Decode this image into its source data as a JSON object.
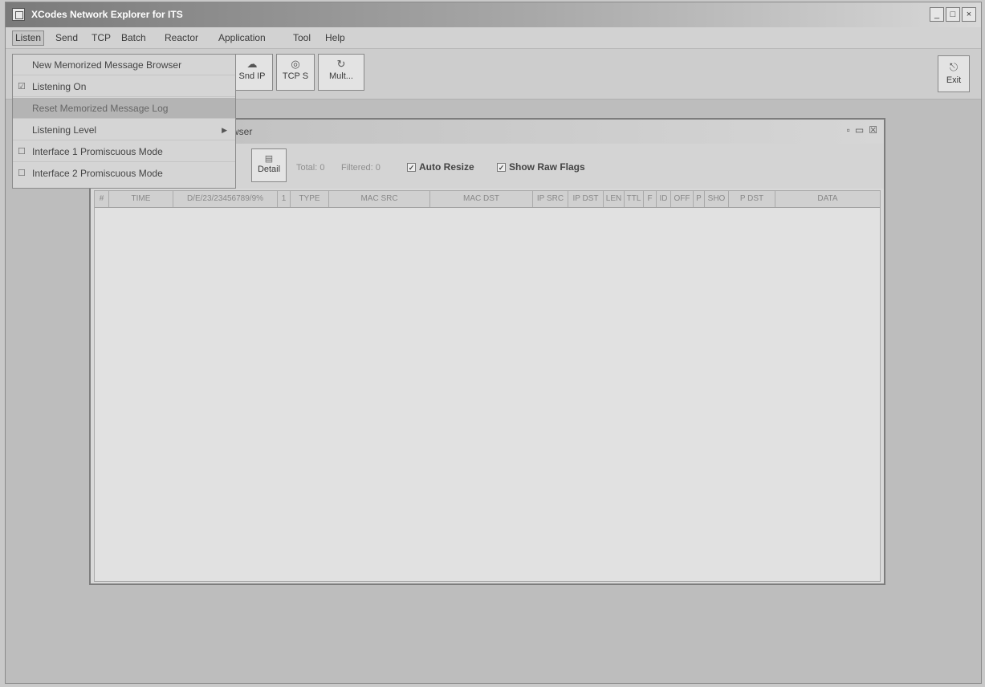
{
  "window": {
    "title": "XCodes Network Explorer for ITS"
  },
  "menubar": [
    "Listen",
    "Send",
    "TCP",
    "Batch",
    "Reactor",
    "Application",
    "Tool",
    "Help"
  ],
  "toolbar": {
    "buttons": [
      {
        "label": "Snd IP",
        "icon": "network-icon"
      },
      {
        "label": "TCP S",
        "icon": "plug-icon"
      },
      {
        "label": "Mult...",
        "icon": "refresh-icon"
      }
    ],
    "exit": "Exit"
  },
  "listen_menu": [
    {
      "label": "New Memorized Message Browser",
      "mark": ""
    },
    {
      "label": "Listening On",
      "mark": "☑"
    },
    {
      "label": "Reset Memorized Message Log",
      "mark": ""
    },
    {
      "label": "Listening Level",
      "mark": "",
      "submenu": true
    },
    {
      "label": "Interface 1 Promiscuous Mode",
      "mark": "☐"
    },
    {
      "label": "Interface 2 Promiscuous Mode",
      "mark": "☐"
    }
  ],
  "browser": {
    "title_fragment": "wser",
    "detail_label": "Detail",
    "total": "Total: 0",
    "filtered": "Filtered: 0",
    "auto_resize": "Auto Resize",
    "show_raw_flags": "Show Raw Flags",
    "columns": [
      "#",
      "TIME",
      "D/E/23/23456789/9%",
      "1",
      "TYPE",
      "MAC SRC",
      "MAC DST",
      "IP SRC",
      "IP DST",
      "LEN",
      "TTL",
      "F",
      "ID",
      "OFF",
      "P",
      "SHO",
      "P DST",
      "DATA"
    ]
  }
}
